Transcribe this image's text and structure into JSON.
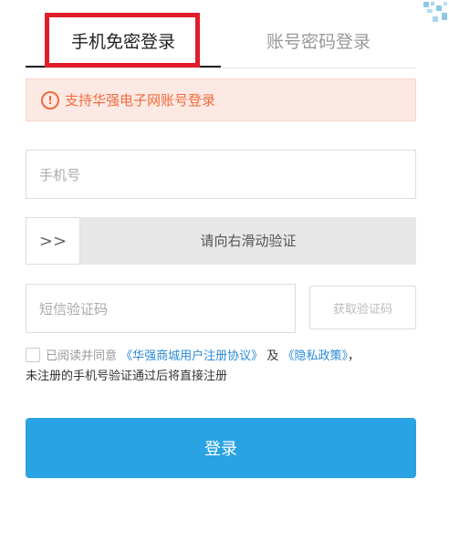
{
  "tabs": {
    "active": "手机免密登录",
    "inactive": "账号密码登录"
  },
  "notice": {
    "icon": "!",
    "text": "支持华强电子网账号登录"
  },
  "phone": {
    "placeholder": "手机号"
  },
  "slider": {
    "handle": ">>",
    "text": "请向右滑动验证"
  },
  "sms": {
    "placeholder": "短信验证码",
    "get_code": "获取验证码"
  },
  "agreement": {
    "prefix": "已阅读并同意",
    "link1": "《华强商城用户注册协议》",
    "and": "及",
    "link2": "《隐私政策》",
    "comma": "，",
    "note": "未注册的手机号验证通过后将直接注册"
  },
  "login_button": "登录",
  "colors": {
    "accent": "#29a3e3",
    "warning": "#ef6a3c",
    "highlight": "#e11d2b"
  }
}
